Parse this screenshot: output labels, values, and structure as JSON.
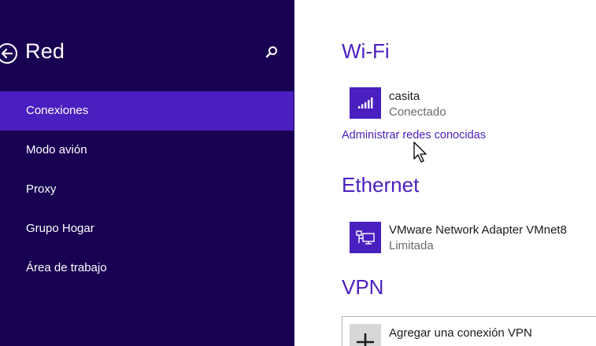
{
  "header": {
    "title": "Red",
    "back_icon": "back-arrow-circle-icon",
    "search_icon": "search-icon"
  },
  "sidebar": {
    "items": [
      {
        "label": "Conexiones",
        "selected": true
      },
      {
        "label": "Modo avión",
        "selected": false
      },
      {
        "label": "Proxy",
        "selected": false
      },
      {
        "label": "Grupo Hogar",
        "selected": false
      },
      {
        "label": "Área de trabajo",
        "selected": false
      }
    ]
  },
  "wifi": {
    "heading": "Wi-Fi",
    "network": {
      "name": "casita",
      "status": "Conectado",
      "icon": "wifi-signal-icon"
    },
    "manage_link": "Administrar redes conocidas"
  },
  "ethernet": {
    "heading": "Ethernet",
    "adapter": {
      "name": "VMware Network Adapter VMnet8",
      "status": "Limitada",
      "icon": "ethernet-network-icon"
    }
  },
  "vpn": {
    "heading": "VPN",
    "add_label": "Agregar una conexión VPN",
    "icon": "plus-icon"
  },
  "colors": {
    "nav_background": "#180052",
    "accent": "#4a1fbf",
    "selected_item": "#4a1fbf",
    "content_background": "#ffffff"
  }
}
